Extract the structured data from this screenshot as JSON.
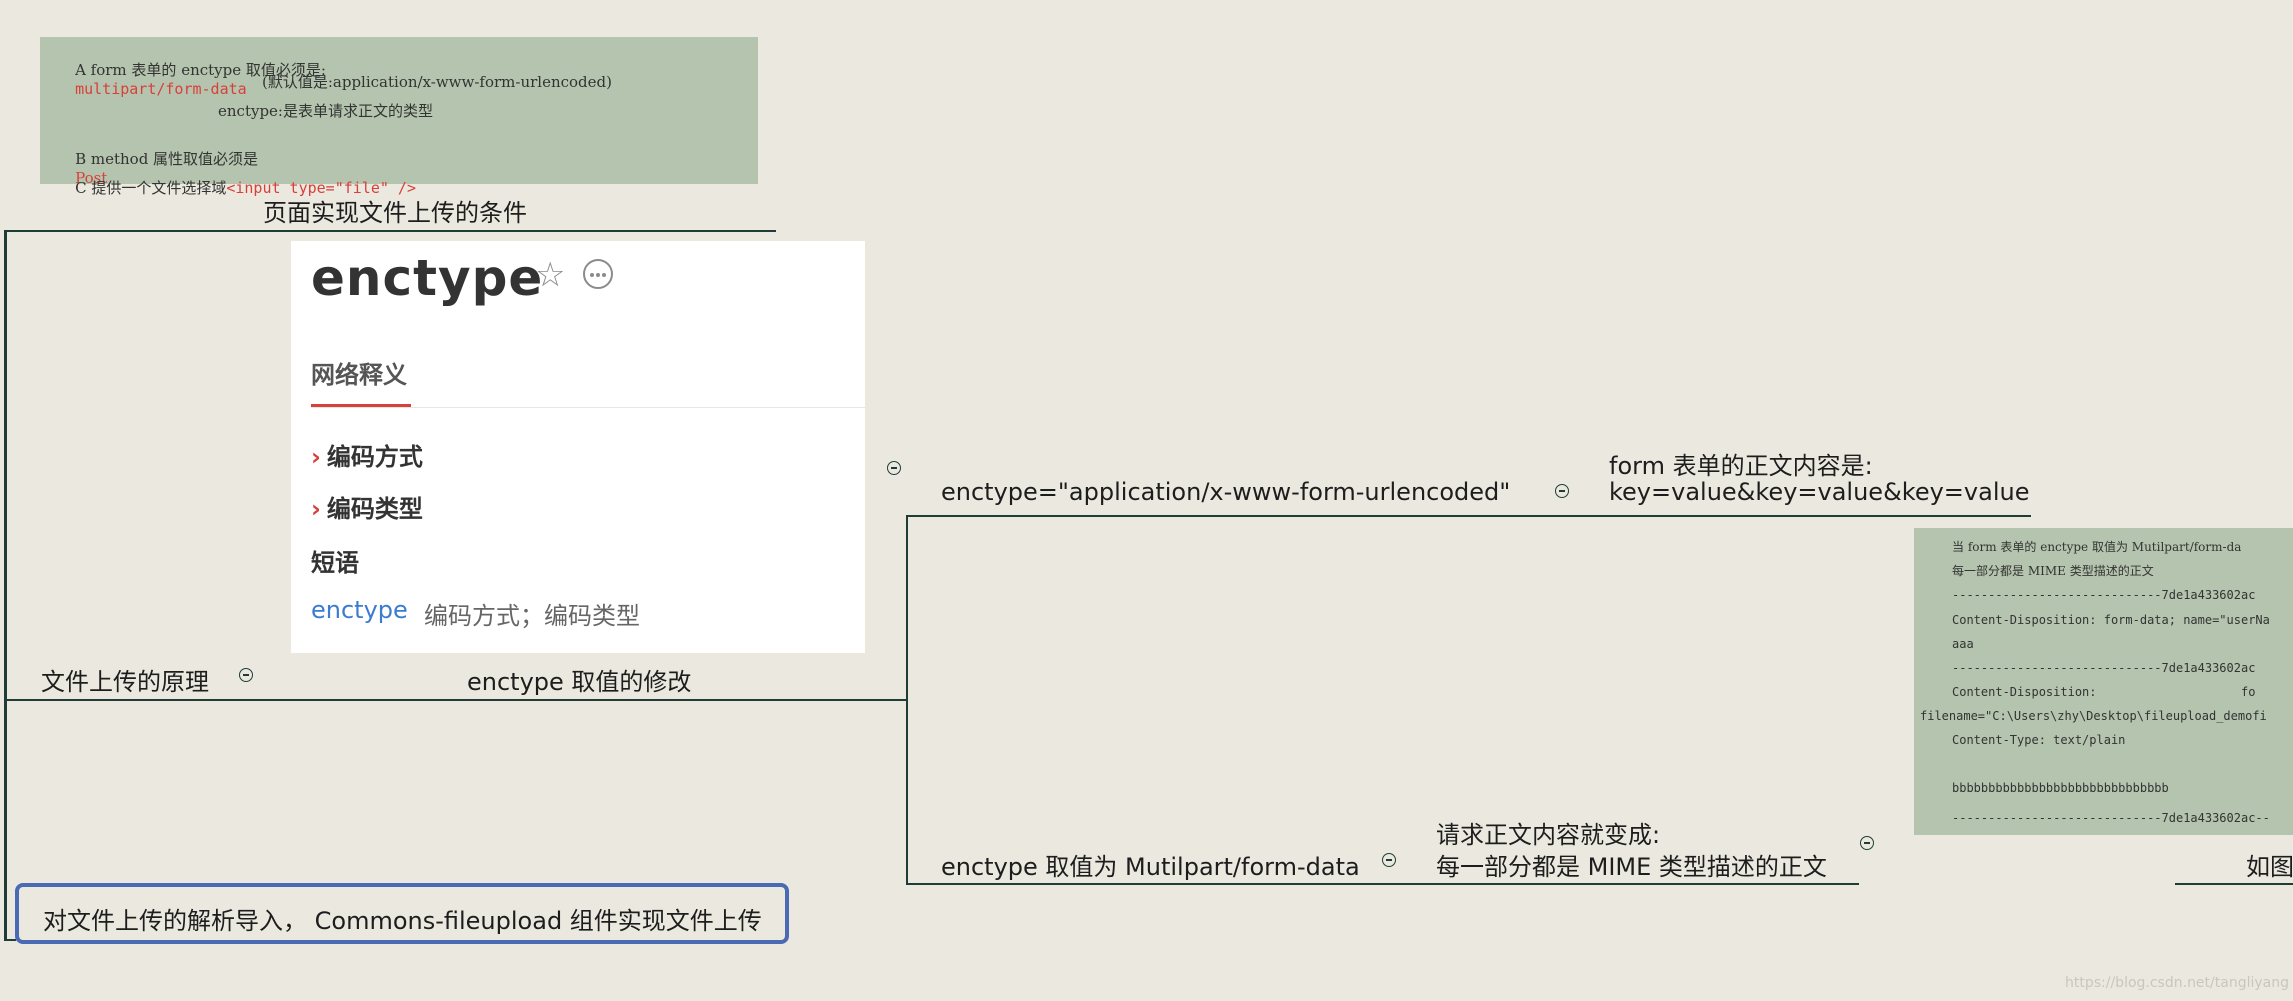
{
  "condition_note": {
    "line_a_prefix": "A form 表单的 enctype 取值必须是:",
    "line_a_value": "multipart/form-data",
    "line_a_default": "(默认值是:application/x-www-form-urlencoded)",
    "line_a_desc": "enctype:是表单请求正文的类型",
    "line_b_prefix": "B method 属性取值必须是",
    "line_b_value": "Post",
    "line_c_prefix": "C 提供一个文件选择域",
    "line_c_value": "<input type=\"file\" />"
  },
  "nodes": {
    "conditions": "页面实现文件上传的条件",
    "principle": "文件上传的原理",
    "enctype_change": "enctype 取值的修改",
    "urlencoded": "enctype=\"application/x-www-form-urlencoded\"",
    "urlencoded_body_line1": "form 表单的正文内容是:",
    "urlencoded_body_line2": "key=value&key=value&key=value",
    "multipart": "enctype 取值为 Mutilpart/form-data",
    "multipart_body_line1": "请求正文内容就变成:",
    "multipart_body_line2": "每一部分都是 MIME 类型描述的正文",
    "as_figure": "如图",
    "summary": "对文件上传的解析导入， Commons-fileupload 组件实现文件上传"
  },
  "dictionary": {
    "word": "enctype",
    "tab": "网络释义",
    "meanings": [
      "编码方式",
      "编码类型"
    ],
    "phrase_heading": "短语",
    "phrase_word": "enctype",
    "phrase_definition": "编码方式；编码类型",
    "icons": [
      "star-icon",
      "more-icon",
      "chevron-right-icon"
    ]
  },
  "multipart_note": {
    "lines": [
      "当 form 表单的 enctype 取值为 Mutilpart/form-da",
      "每一部分都是 MIME 类型描述的正文",
      "-----------------------------7de1a433602ac",
      "Content-Disposition: form-data; name=\"userNa",
      "aaa",
      "-----------------------------7de1a433602ac",
      "Content-Disposition:                    fo",
      "filename=\"C:\\Users\\zhy\\Desktop\\fileupload_demofi",
      "Content-Type: text/plain",
      "",
      "bbbbbbbbbbbbbbbbbbbbbbbbbbbbbb",
      "-----------------------------7de1a433602ac--"
    ]
  },
  "watermark": "https://blog.csdn.net/tangliyang",
  "colors": {
    "background": "#ebe9df",
    "note": "#b5c4ae",
    "line": "#1f3d36",
    "highlight_border": "#4a6bb3",
    "accent_red": "#d8403a"
  }
}
